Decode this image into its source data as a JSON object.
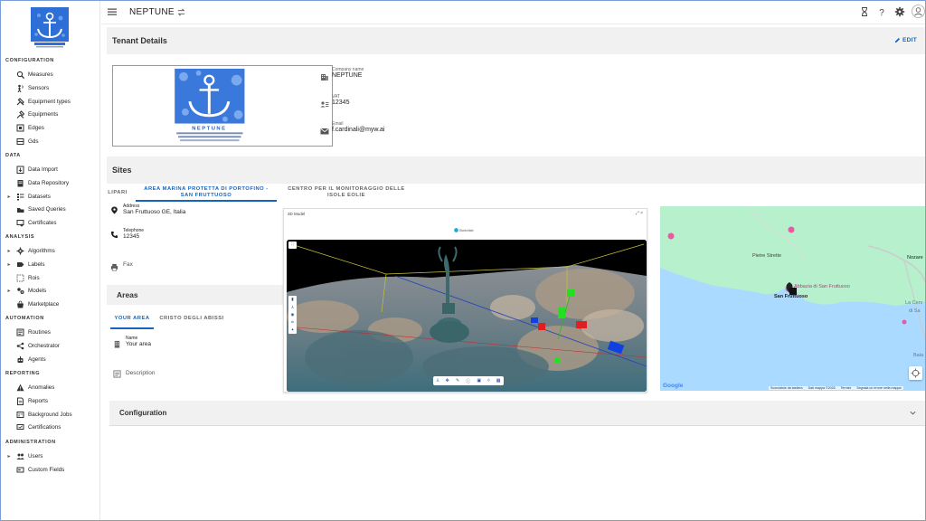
{
  "sidebar": {
    "sections": [
      {
        "title": "CONFIGURATION",
        "items": [
          {
            "label": "Measures",
            "icon": "measure-icon",
            "expandable": false
          },
          {
            "label": "Sensors",
            "icon": "sensor-icon",
            "expandable": false
          },
          {
            "label": "Equipment types",
            "icon": "tools-icon",
            "expandable": false
          },
          {
            "label": "Equipments",
            "icon": "equipment-icon",
            "expandable": false
          },
          {
            "label": "Edges",
            "icon": "edge-icon",
            "expandable": false
          },
          {
            "label": "Gds",
            "icon": "gds-icon",
            "expandable": false
          }
        ]
      },
      {
        "title": "DATA",
        "items": [
          {
            "label": "Data Import",
            "icon": "import-icon",
            "expandable": false
          },
          {
            "label": "Data Repository",
            "icon": "repository-icon",
            "expandable": false
          },
          {
            "label": "Datasets",
            "icon": "dataset-icon",
            "expandable": true
          },
          {
            "label": "Saved Queries",
            "icon": "query-icon",
            "expandable": false
          },
          {
            "label": "Certificates",
            "icon": "certificate-icon",
            "expandable": false
          }
        ]
      },
      {
        "title": "ANALYSIS",
        "items": [
          {
            "label": "Algorithms",
            "icon": "algorithm-icon",
            "expandable": true
          },
          {
            "label": "Labels",
            "icon": "label-icon",
            "expandable": true
          },
          {
            "label": "Rois",
            "icon": "roi-icon",
            "expandable": false
          },
          {
            "label": "Models",
            "icon": "model-icon",
            "expandable": true
          },
          {
            "label": "Marketplace",
            "icon": "marketplace-icon",
            "expandable": false
          }
        ]
      },
      {
        "title": "AUTOMATION",
        "items": [
          {
            "label": "Routines",
            "icon": "routine-icon",
            "expandable": false
          },
          {
            "label": "Orchestrator",
            "icon": "orchestrator-icon",
            "expandable": false
          },
          {
            "label": "Agents",
            "icon": "agent-icon",
            "expandable": false
          }
        ]
      },
      {
        "title": "REPORTING",
        "items": [
          {
            "label": "Anomalies",
            "icon": "warning-icon",
            "expandable": false
          },
          {
            "label": "Reports",
            "icon": "report-icon",
            "expandable": false
          },
          {
            "label": "Background Jobs",
            "icon": "job-icon",
            "expandable": false
          },
          {
            "label": "Certifications",
            "icon": "certification-icon",
            "expandable": false
          }
        ]
      },
      {
        "title": "ADMINISTRATION",
        "items": [
          {
            "label": "Users",
            "icon": "users-icon",
            "expandable": true
          },
          {
            "label": "Custom Fields",
            "icon": "custom-field-icon",
            "expandable": false
          }
        ]
      }
    ]
  },
  "topbar": {
    "tenant": "NEPTUNE"
  },
  "tenant_details": {
    "title": "Tenant Details",
    "edit_label": "EDIT",
    "company_label": "Company name",
    "company_value": "NEPTUNE",
    "vat_label": "VAT",
    "vat_value": "12345",
    "email_label": "Email",
    "email_value": "f.cardinali@myw.ai",
    "logo_text": "NEPTUNE"
  },
  "sites": {
    "title": "Sites",
    "tabs": [
      {
        "label": "LIPARI"
      },
      {
        "label": "AREA MARINA PROTETTA DI PORTOFINO - SAN FRUTTUOSO"
      },
      {
        "label": "CENTRO PER IL MONITORAGGIO DELLE ISOLE EOLIE"
      }
    ],
    "address_label": "Address",
    "address_value": "San Fruttuoso GE, Italia",
    "telephone_label": "Telephone",
    "telephone_value": "12345",
    "fax_label": "Fax"
  },
  "areas": {
    "title": "Areas",
    "tabs": [
      {
        "label": "YOUR AREA"
      },
      {
        "label": "CRISTO DEGLI ABISSI"
      }
    ],
    "name_label": "Name",
    "name_value": "Your area",
    "description_label": "Description"
  },
  "viewer": {
    "title": "3D Model",
    "controls": "⤢ ×",
    "brand": "Sketchfab"
  },
  "map": {
    "labels": [
      "Pietre Strette",
      "Abbazia di San Fruttuoso",
      "San Fruttuoso",
      "Nozare",
      "La Cerv",
      "di Sa",
      "Baia"
    ],
    "google": "Google",
    "footer": [
      "Scorciatoie da tastiera",
      "Dati mappa ©2025",
      "Termini",
      "Segnala un errore nella mappa"
    ]
  },
  "configuration": {
    "title": "Configuration"
  },
  "colors": {
    "accent": "#1565c0",
    "map_land": "#b7f0cc",
    "map_sea": "#aadaff",
    "header_bg": "#f1f1f1"
  }
}
